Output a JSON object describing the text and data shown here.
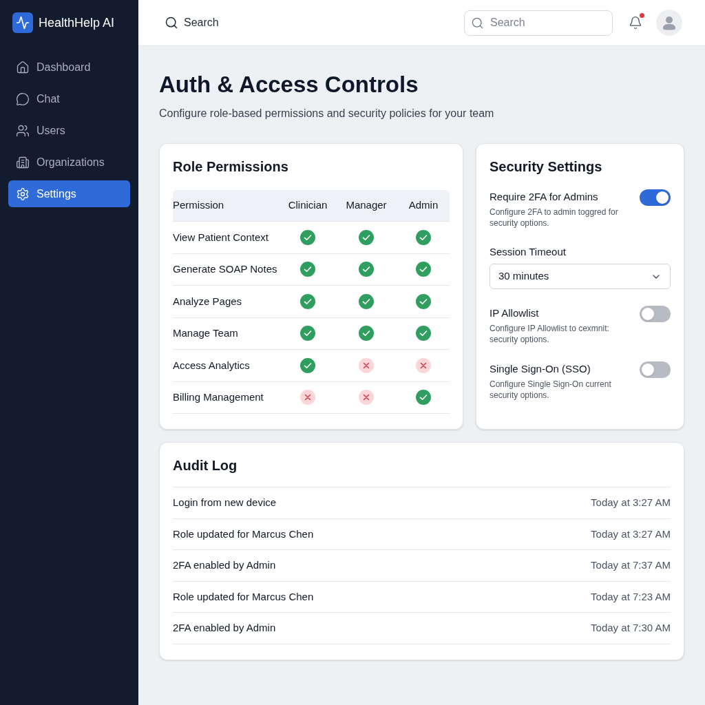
{
  "sidebar": {
    "brand": "HealthHelp AI",
    "items": [
      {
        "label": "Dashboard",
        "selected": false
      },
      {
        "label": "Chat",
        "selected": false
      },
      {
        "label": "Users",
        "selected": false
      },
      {
        "label": "Organizations",
        "selected": false
      },
      {
        "label": "Settings",
        "selected": true
      }
    ]
  },
  "header": {
    "search_label": "Search",
    "search": {
      "placeholder": "Search"
    },
    "notifications": {
      "unread": true
    }
  },
  "page": {
    "title": "Auth & Access Controls",
    "subtitle": "Configure role-based permissions and security policies for your team"
  },
  "role_permissions": {
    "title": "Role Permissions",
    "columns": [
      "Permission",
      "Clinician",
      "Manager",
      "Admin"
    ],
    "rows": [
      {
        "permission": "View Patient Context",
        "grants": [
          true,
          true,
          true
        ]
      },
      {
        "permission": "Generate SOAP Notes",
        "grants": [
          true,
          true,
          true
        ]
      },
      {
        "permission": "Analyze Pages",
        "grants": [
          true,
          true,
          true
        ]
      },
      {
        "permission": "Manage Team",
        "grants": [
          true,
          true,
          true
        ]
      },
      {
        "permission": "Access Analytics",
        "grants": [
          true,
          false,
          false
        ]
      },
      {
        "permission": "Billing Management",
        "grants": [
          false,
          false,
          true
        ]
      }
    ]
  },
  "security_settings": {
    "title": "Security Settings",
    "items": [
      {
        "kind": "toggle",
        "label": "Require 2FA for Admins",
        "description": "Configure 2FA to admin toggred for security options.",
        "on": true
      },
      {
        "kind": "select",
        "label": "Session Timeout",
        "value": "30 minutes"
      },
      {
        "kind": "toggle",
        "label": "IP Allowlist",
        "description": "Configure IP Allowlist to cexmnit: security options.",
        "on": false
      },
      {
        "kind": "toggle",
        "label": "Single Sign-On (SSO)",
        "description": "Configure Single Sign-On current security options.",
        "on": false
      }
    ]
  },
  "audit_log": {
    "title": "Audit Log",
    "entries": [
      {
        "event": "Login from new device",
        "time": "Today at 3:27 AM"
      },
      {
        "event": "Role updated for Marcus Chen",
        "time": "Today at 3:27 AM"
      },
      {
        "event": "2FA enabled by Admin",
        "time": "Today at 7:37 AM"
      },
      {
        "event": "Role updated for Marcus Chen",
        "time": "Today at 7:23 AM"
      },
      {
        "event": "2FA enabled by Admin",
        "time": "Today at 7:30 AM"
      }
    ]
  }
}
